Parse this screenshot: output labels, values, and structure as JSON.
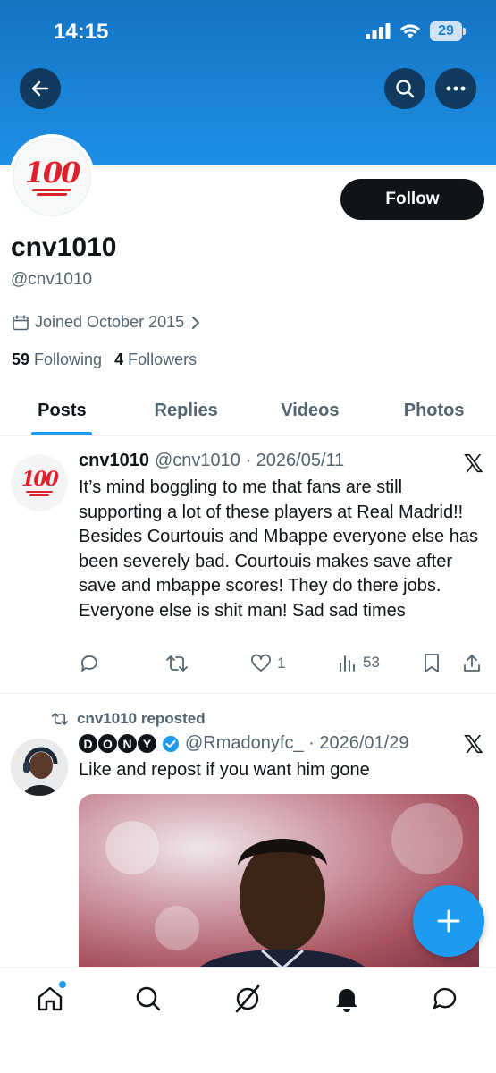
{
  "status_bar": {
    "time": "14:15",
    "battery": "29"
  },
  "header": {
    "back_icon": "arrow-left-icon",
    "search_icon": "search-icon",
    "more_icon": "more-horizontal-icon",
    "banner_color": "#1d8fe4"
  },
  "profile": {
    "display_name": "cnv1010",
    "handle": "@cnv1010",
    "joined": "Joined October 2015",
    "following_count": "59",
    "following_label": "Following",
    "followers_count": "4",
    "followers_label": "Followers",
    "follow_label": "Follow",
    "avatar_emoji": "100"
  },
  "tabs": [
    {
      "label": "Posts",
      "active": true
    },
    {
      "label": "Replies",
      "active": false
    },
    {
      "label": "Videos",
      "active": false
    },
    {
      "label": "Photos",
      "active": false
    }
  ],
  "posts": [
    {
      "name": "cnv1010",
      "meta": "@cnv1010 · 2026/05/11",
      "text": "It’s mind boggling to me that fans are still supporting a lot of these players at Real Madrid!! Besides Courtouis and Mbappe everyone else has been severely bad. Courtouis makes save after save and mbappe scores! They do there jobs. Everyone else is shit man! Sad sad times",
      "likes": "1",
      "views": "53"
    },
    {
      "repost_label": "cnv1010 reposted",
      "name_letters": [
        "D",
        "O",
        "N",
        "Y"
      ],
      "meta": "@Rmadonyfc_ · 2026/01/29",
      "text": "Like and repost if you want him gone"
    }
  ],
  "accent_color": "#1d9bf0",
  "bottom_nav": [
    "home-icon",
    "search-icon",
    "grok-icon",
    "notifications-icon",
    "messages-icon"
  ]
}
